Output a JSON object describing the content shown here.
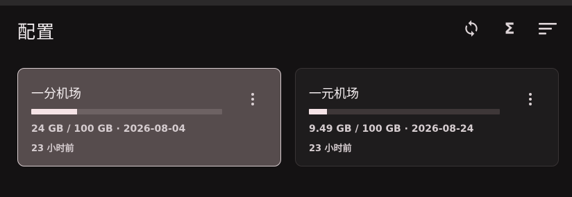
{
  "page": {
    "title": "配置"
  },
  "toolbar": {
    "icons": [
      "refresh-icon",
      "sigma-icon",
      "sort-icon"
    ],
    "sigma_glyph": "Σ"
  },
  "profiles": [
    {
      "name": "一分机场",
      "usage_text": "24 GB / 100 GB · 2026-08-04",
      "usage_fraction": 0.24,
      "updated": "23 小时前",
      "selected": true
    },
    {
      "name": "一元机场",
      "usage_text": "9.49 GB / 100 GB · 2026-08-24",
      "usage_fraction": 0.0949,
      "updated": "23 小时前",
      "selected": false
    }
  ],
  "colors": {
    "background": "#141213",
    "selected_card": "#564c4d",
    "card": "#1e1c1d",
    "bar_fill": "#f5e3e6"
  }
}
